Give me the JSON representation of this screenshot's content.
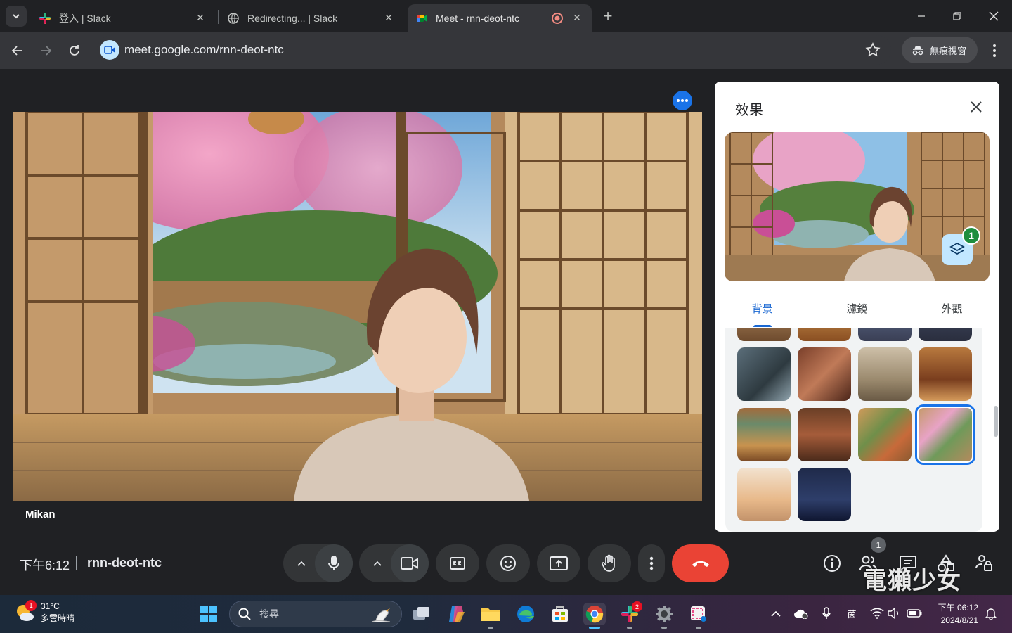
{
  "browser": {
    "tabs": [
      {
        "title": "登入 | Slack",
        "icon": "slack-icon",
        "active": false
      },
      {
        "title": "Redirecting... | Slack",
        "icon": "globe-icon",
        "active": false
      },
      {
        "title": "Meet - rnn-deot-ntc",
        "icon": "google-meet-icon",
        "active": true
      }
    ],
    "url": "meet.google.com/rnn-deot-ntc",
    "incognito_label": "無痕視窗"
  },
  "meet": {
    "participant_name": "Mikan",
    "time": "下午6:12",
    "meeting_code": "rnn-deot-ntc",
    "people_count": "1"
  },
  "effects_panel": {
    "title": "效果",
    "tabs": [
      "背景",
      "濾鏡",
      "外觀"
    ],
    "active_tab": "背景",
    "applied_effects_count": "1"
  },
  "watermark": "電獺少女",
  "taskbar": {
    "weather_temp": "31°C",
    "weather_desc": "多雲時晴",
    "weather_badge": "1",
    "search_placeholder": "搜尋",
    "slack_badge": "2",
    "ime_label": "茵",
    "clock_time": "下午 06:12",
    "clock_date": "2024/8/21"
  },
  "colors": {
    "accent": "#1a73e8",
    "end_call": "#ea4335",
    "badge_green": "#1e8e3e"
  }
}
